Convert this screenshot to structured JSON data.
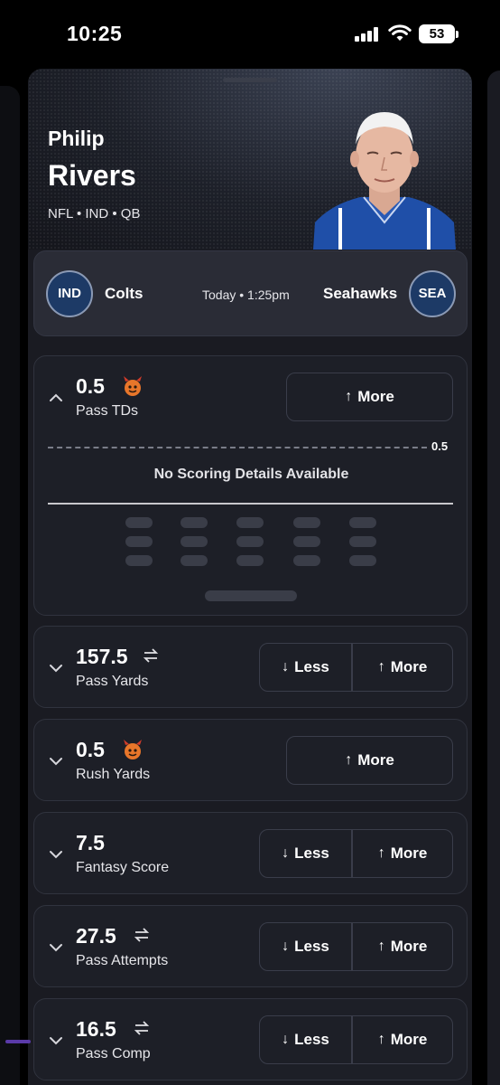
{
  "status_bar": {
    "time": "10:25",
    "battery": "53"
  },
  "player": {
    "first_name": "Philip",
    "last_name": "Rivers",
    "meta": "NFL • IND  • QB"
  },
  "matchup": {
    "home_abbr": "IND",
    "home_name": "Colts",
    "time": "Today • 1:25pm",
    "away_name": "Seahawks",
    "away_abbr": "SEA"
  },
  "expanded": {
    "line_label": "0.5",
    "no_scoring": "No Scoring Details Available"
  },
  "props": [
    {
      "value": "0.5",
      "stat": "Pass TDs",
      "icon": "demon-icon",
      "more": "More",
      "less": ""
    },
    {
      "value": "157.5",
      "stat": "Pass Yards",
      "icon": "swap-icon",
      "more": "More",
      "less": "Less"
    },
    {
      "value": "0.5",
      "stat": "Rush Yards",
      "icon": "demon-icon",
      "more": "More",
      "less": ""
    },
    {
      "value": "7.5",
      "stat": "Fantasy Score",
      "icon": "",
      "more": "More",
      "less": "Less"
    },
    {
      "value": "27.5",
      "stat": "Pass Attempts",
      "icon": "swap-icon",
      "more": "More",
      "less": "Less"
    },
    {
      "value": "16.5",
      "stat": "Pass Comp",
      "icon": "swap-icon",
      "more": "More",
      "less": "Less"
    }
  ],
  "colors": {
    "background": "#000000",
    "card": "#1a1b22",
    "prop_card": "#1d1f27",
    "team_badge": "#1d3a66"
  }
}
